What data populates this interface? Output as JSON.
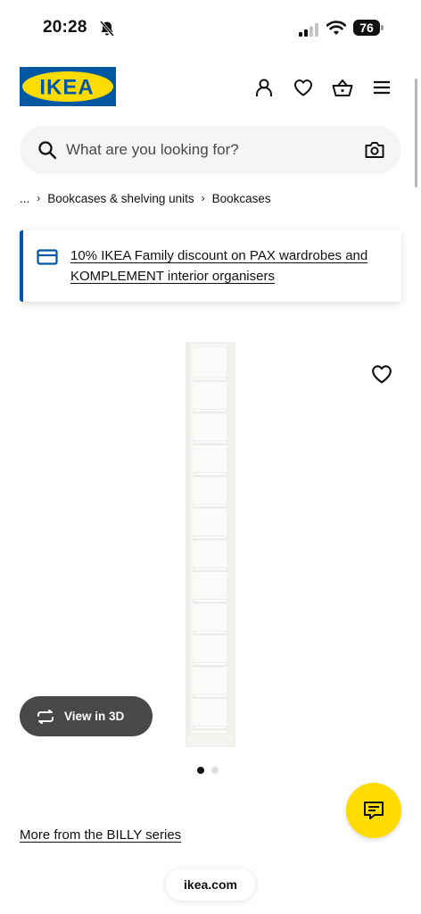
{
  "status_bar": {
    "time": "20:28",
    "battery": "76",
    "icons": [
      "bell-slash-icon",
      "signal-icon",
      "wifi-icon",
      "battery-icon"
    ]
  },
  "header": {
    "logo_text": "IKEA",
    "icons": [
      "user-icon",
      "heart-icon",
      "basket-icon",
      "menu-icon"
    ]
  },
  "search": {
    "placeholder": "What are you looking for?",
    "icons": [
      "search-icon",
      "camera-icon"
    ]
  },
  "breadcrumb": {
    "ellipsis": "...",
    "items": [
      "Bookcases & shelving units",
      "Bookcases"
    ]
  },
  "banner": {
    "icon": "card-icon",
    "text": "10% IKEA Family discount on PAX wardrobes and KOMPLEMENT interior organisers"
  },
  "product": {
    "view_3d_label": "View in 3D",
    "image_count": 2,
    "active_image": 1
  },
  "series_link": "More from the BILLY series",
  "browser": {
    "url": "ikea.com"
  },
  "colors": {
    "ikea_blue": "#0058a3",
    "ikea_yellow": "#ffdb00",
    "dark_pill": "#484848"
  }
}
